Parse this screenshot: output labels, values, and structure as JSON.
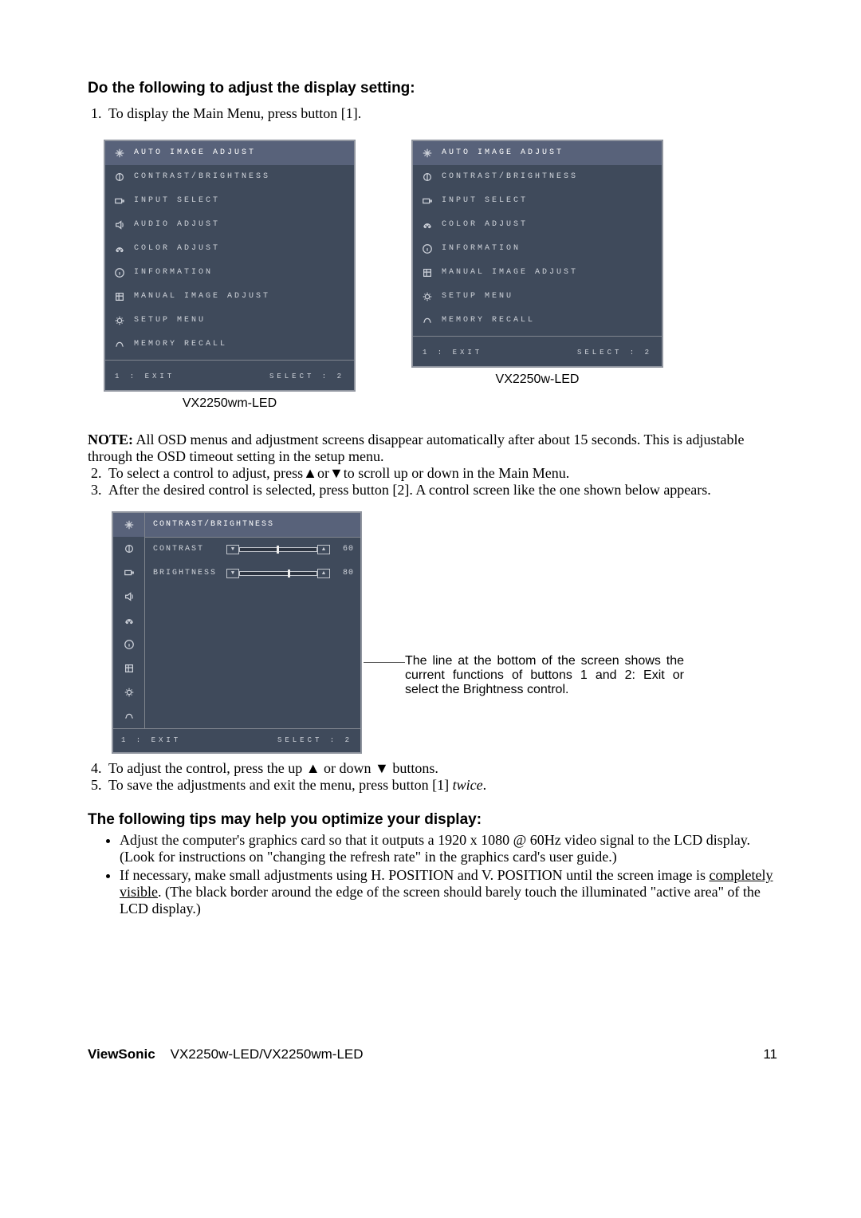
{
  "heading1": "Do the following to adjust the display setting:",
  "steps": {
    "s1": "To display the Main Menu, press button [1].",
    "s2": "To select a control to adjust, press▲or▼to scroll up or down in the Main Menu.",
    "s3": "After the desired control is selected, press button [2]. A control screen like the one shown below appears.",
    "s4": "To adjust the control, press the up ▲ or down ▼ buttons.",
    "s5_a": "To save the adjustments and exit the menu, press button [1] ",
    "s5_b": "twice",
    "s5_c": "."
  },
  "osdA": {
    "caption": "VX2250wm-LED",
    "items": [
      "AUTO IMAGE ADJUST",
      "CONTRAST/BRIGHTNESS",
      "INPUT SELECT",
      "AUDIO ADJUST",
      "COLOR ADJUST",
      "INFORMATION",
      "MANUAL IMAGE ADJUST",
      "SETUP MENU",
      "MEMORY RECALL"
    ],
    "footer_left": "1 : EXIT",
    "footer_right": "SELECT : 2"
  },
  "osdB": {
    "caption": "VX2250w-LED",
    "items": [
      "AUTO IMAGE ADJUST",
      "CONTRAST/BRIGHTNESS",
      "INPUT SELECT",
      "COLOR ADJUST",
      "INFORMATION",
      "MANUAL IMAGE ADJUST",
      "SETUP MENU",
      "MEMORY RECALL"
    ],
    "footer_left": "1 : EXIT",
    "footer_right": "SELECT : 2"
  },
  "note_label": "NOTE:",
  "note_text": " All OSD menus and adjustment screens disappear automatically after about 15 seconds. This is adjustable through the OSD timeout setting in the setup menu.",
  "osdC": {
    "title": "CONTRAST/BRIGHTNESS",
    "controls": [
      {
        "label": "CONTRAST",
        "value": "60"
      },
      {
        "label": "BRIGHTNESS",
        "value": "80"
      }
    ],
    "footer_left": "1 : EXIT",
    "footer_right": "SELECT : 2",
    "icon_count": 9
  },
  "callout": "The line at the bottom of the screen shows the current functions of buttons 1 and 2: Exit or select the Brightness control.",
  "tips_heading": "The following tips may help you optimize your display:",
  "tips": {
    "t1": "Adjust the computer's graphics card so that it outputs a 1920 x 1080 @ 60Hz video signal to the LCD display. (Look for instructions on \"changing the refresh rate\" in the graphics card's user guide.)",
    "t2a": "If necessary, make small adjustments using H. POSITION and V. POSITION until the screen image is ",
    "t2b": "completely visible",
    "t2c": ". (The black border around the edge of the screen should barely touch the illuminated \"active area\" of the LCD display.)"
  },
  "footer": {
    "brand": "ViewSonic",
    "model": "VX2250w-LED/VX2250wm-LED",
    "page": "11"
  },
  "icons": {
    "arrows": "arrows-expand-icon",
    "contrast": "brightness-contrast-icon",
    "input": "input-port-icon",
    "audio": "speaker-icon",
    "color": "palette-icon",
    "info": "info-circle-icon",
    "manual": "image-adjust-icon",
    "setup": "gear-icon",
    "recall": "memory-recall-icon"
  }
}
